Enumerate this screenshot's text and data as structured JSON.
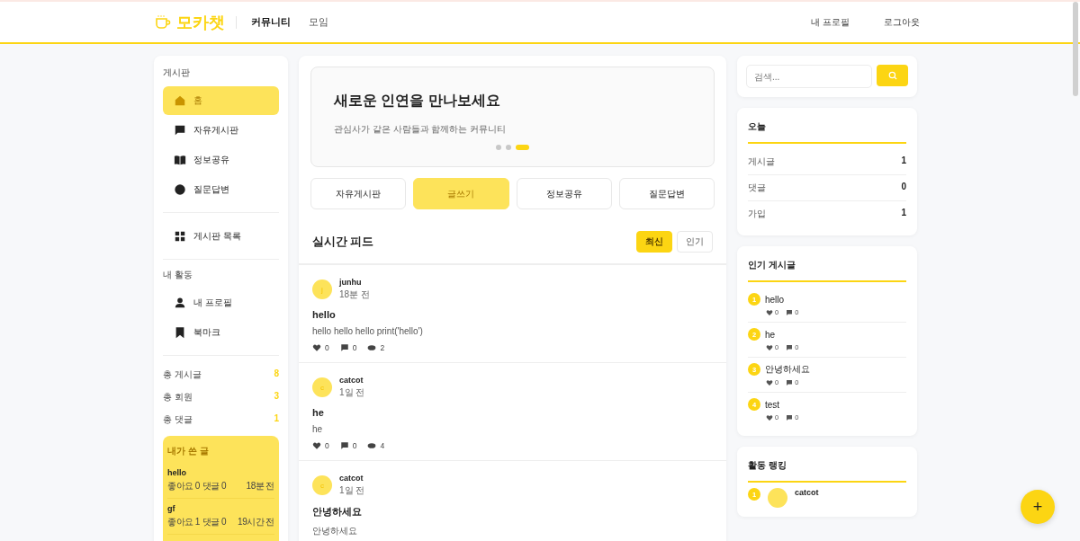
{
  "header": {
    "logo": "모카챗",
    "nav": [
      {
        "label": "커뮤니티",
        "selected": true
      },
      {
        "label": "모임",
        "selected": false
      }
    ],
    "actions": [
      "내 프로필",
      "로그아웃"
    ]
  },
  "sidebar": {
    "boards_title": "게시판",
    "boards": [
      {
        "label": "홈",
        "kind": "home",
        "selected": true
      },
      {
        "label": "자유게시판",
        "kind": "chat",
        "selected": false
      },
      {
        "label": "정보공유",
        "kind": "book",
        "selected": false
      },
      {
        "label": "질문답변",
        "kind": "circle",
        "selected": false
      }
    ],
    "board_list": {
      "label": "게시판 목록",
      "kind": "grid",
      "selected": false
    },
    "activity_title": "내 활동",
    "activity": [
      {
        "label": "내 프로필",
        "kind": "person",
        "selected": false
      },
      {
        "label": "북마크",
        "kind": "bookmark",
        "selected": false
      }
    ],
    "stats": [
      {
        "label": "총 게시글",
        "value": "8"
      },
      {
        "label": "총 회원",
        "value": "3"
      },
      {
        "label": "총 댓글",
        "value": "1"
      }
    ],
    "my_posts": {
      "title": "내가 쓴 글",
      "items": [
        {
          "title": "hello",
          "likes": "좋아요 0",
          "comments": "댓글 0",
          "time": "18분 전"
        },
        {
          "title": "gf",
          "likes": "좋아요 1",
          "comments": "댓글 0",
          "time": "19시간 전"
        }
      ]
    }
  },
  "banner": {
    "title": "새로운 인연을 만나보세요",
    "subtitle": "관심사가 같은 사람들과 함께하는 커뮤니티",
    "dots": [
      {
        "selected": false
      },
      {
        "selected": false
      },
      {
        "selected": true
      }
    ]
  },
  "quick_buttons": [
    {
      "label": "자유게시판",
      "selected": false
    },
    {
      "label": "글쓰기",
      "selected": true
    },
    {
      "label": "정보공유",
      "selected": false
    },
    {
      "label": "질문답변",
      "selected": false
    }
  ],
  "feed": {
    "title": "실시간 피드",
    "sort": [
      {
        "label": "최신",
        "selected": true
      },
      {
        "label": "인기",
        "selected": false
      }
    ],
    "posts": [
      {
        "avatar": "j",
        "author": "junhu",
        "time": "18분 전",
        "title": "hello",
        "body": "hello hello hello print('hello')",
        "likes": "0",
        "comments": "0",
        "views": "2"
      },
      {
        "avatar": "c",
        "author": "catcot",
        "time": "1일 전",
        "title": "he",
        "body": "he",
        "likes": "0",
        "comments": "0",
        "views": "4"
      },
      {
        "avatar": "c",
        "author": "catcot",
        "time": "1일 전",
        "title": "안녕하세요",
        "body": "안녕하세요"
      }
    ]
  },
  "search": {
    "placeholder": "검색..."
  },
  "today": {
    "title": "오늘",
    "rows": [
      {
        "label": "게시글",
        "value": "1"
      },
      {
        "label": "댓글",
        "value": "0"
      },
      {
        "label": "가입",
        "value": "1"
      }
    ]
  },
  "popular": {
    "title": "인기 게시글",
    "items": [
      {
        "rank": "1",
        "title": "hello",
        "likes": "0",
        "comments": "0"
      },
      {
        "rank": "2",
        "title": "he",
        "likes": "0",
        "comments": "0"
      },
      {
        "rank": "3",
        "title": "안녕하세요",
        "likes": "0",
        "comments": "0"
      },
      {
        "rank": "4",
        "title": "test",
        "likes": "0",
        "comments": "0"
      }
    ]
  },
  "ranking": {
    "title": "활동 랭킹",
    "items": [
      {
        "rank": "1",
        "name": "catcot"
      }
    ]
  },
  "fab": {
    "label": "+"
  }
}
